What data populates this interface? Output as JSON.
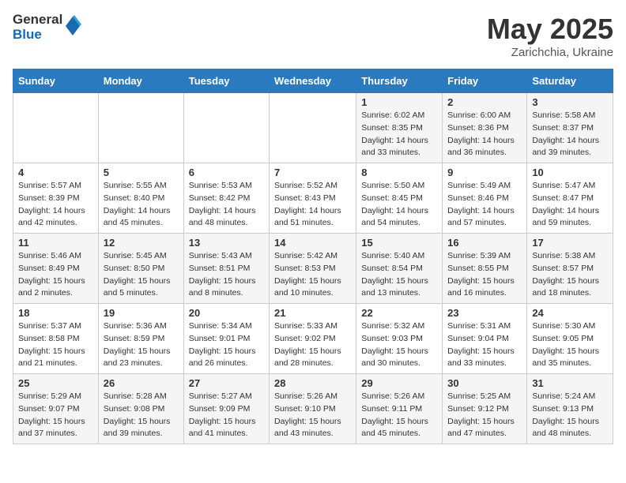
{
  "logo": {
    "general": "General",
    "blue": "Blue"
  },
  "title": {
    "month_year": "May 2025",
    "location": "Zarichchia, Ukraine"
  },
  "headers": [
    "Sunday",
    "Monday",
    "Tuesday",
    "Wednesday",
    "Thursday",
    "Friday",
    "Saturday"
  ],
  "weeks": [
    [
      {
        "day": "",
        "sunrise": "",
        "sunset": "",
        "daylight": ""
      },
      {
        "day": "",
        "sunrise": "",
        "sunset": "",
        "daylight": ""
      },
      {
        "day": "",
        "sunrise": "",
        "sunset": "",
        "daylight": ""
      },
      {
        "day": "",
        "sunrise": "",
        "sunset": "",
        "daylight": ""
      },
      {
        "day": "1",
        "sunrise": "Sunrise: 6:02 AM",
        "sunset": "Sunset: 8:35 PM",
        "daylight": "Daylight: 14 hours and 33 minutes."
      },
      {
        "day": "2",
        "sunrise": "Sunrise: 6:00 AM",
        "sunset": "Sunset: 8:36 PM",
        "daylight": "Daylight: 14 hours and 36 minutes."
      },
      {
        "day": "3",
        "sunrise": "Sunrise: 5:58 AM",
        "sunset": "Sunset: 8:37 PM",
        "daylight": "Daylight: 14 hours and 39 minutes."
      }
    ],
    [
      {
        "day": "4",
        "sunrise": "Sunrise: 5:57 AM",
        "sunset": "Sunset: 8:39 PM",
        "daylight": "Daylight: 14 hours and 42 minutes."
      },
      {
        "day": "5",
        "sunrise": "Sunrise: 5:55 AM",
        "sunset": "Sunset: 8:40 PM",
        "daylight": "Daylight: 14 hours and 45 minutes."
      },
      {
        "day": "6",
        "sunrise": "Sunrise: 5:53 AM",
        "sunset": "Sunset: 8:42 PM",
        "daylight": "Daylight: 14 hours and 48 minutes."
      },
      {
        "day": "7",
        "sunrise": "Sunrise: 5:52 AM",
        "sunset": "Sunset: 8:43 PM",
        "daylight": "Daylight: 14 hours and 51 minutes."
      },
      {
        "day": "8",
        "sunrise": "Sunrise: 5:50 AM",
        "sunset": "Sunset: 8:45 PM",
        "daylight": "Daylight: 14 hours and 54 minutes."
      },
      {
        "day": "9",
        "sunrise": "Sunrise: 5:49 AM",
        "sunset": "Sunset: 8:46 PM",
        "daylight": "Daylight: 14 hours and 57 minutes."
      },
      {
        "day": "10",
        "sunrise": "Sunrise: 5:47 AM",
        "sunset": "Sunset: 8:47 PM",
        "daylight": "Daylight: 14 hours and 59 minutes."
      }
    ],
    [
      {
        "day": "11",
        "sunrise": "Sunrise: 5:46 AM",
        "sunset": "Sunset: 8:49 PM",
        "daylight": "Daylight: 15 hours and 2 minutes."
      },
      {
        "day": "12",
        "sunrise": "Sunrise: 5:45 AM",
        "sunset": "Sunset: 8:50 PM",
        "daylight": "Daylight: 15 hours and 5 minutes."
      },
      {
        "day": "13",
        "sunrise": "Sunrise: 5:43 AM",
        "sunset": "Sunset: 8:51 PM",
        "daylight": "Daylight: 15 hours and 8 minutes."
      },
      {
        "day": "14",
        "sunrise": "Sunrise: 5:42 AM",
        "sunset": "Sunset: 8:53 PM",
        "daylight": "Daylight: 15 hours and 10 minutes."
      },
      {
        "day": "15",
        "sunrise": "Sunrise: 5:40 AM",
        "sunset": "Sunset: 8:54 PM",
        "daylight": "Daylight: 15 hours and 13 minutes."
      },
      {
        "day": "16",
        "sunrise": "Sunrise: 5:39 AM",
        "sunset": "Sunset: 8:55 PM",
        "daylight": "Daylight: 15 hours and 16 minutes."
      },
      {
        "day": "17",
        "sunrise": "Sunrise: 5:38 AM",
        "sunset": "Sunset: 8:57 PM",
        "daylight": "Daylight: 15 hours and 18 minutes."
      }
    ],
    [
      {
        "day": "18",
        "sunrise": "Sunrise: 5:37 AM",
        "sunset": "Sunset: 8:58 PM",
        "daylight": "Daylight: 15 hours and 21 minutes."
      },
      {
        "day": "19",
        "sunrise": "Sunrise: 5:36 AM",
        "sunset": "Sunset: 8:59 PM",
        "daylight": "Daylight: 15 hours and 23 minutes."
      },
      {
        "day": "20",
        "sunrise": "Sunrise: 5:34 AM",
        "sunset": "Sunset: 9:01 PM",
        "daylight": "Daylight: 15 hours and 26 minutes."
      },
      {
        "day": "21",
        "sunrise": "Sunrise: 5:33 AM",
        "sunset": "Sunset: 9:02 PM",
        "daylight": "Daylight: 15 hours and 28 minutes."
      },
      {
        "day": "22",
        "sunrise": "Sunrise: 5:32 AM",
        "sunset": "Sunset: 9:03 PM",
        "daylight": "Daylight: 15 hours and 30 minutes."
      },
      {
        "day": "23",
        "sunrise": "Sunrise: 5:31 AM",
        "sunset": "Sunset: 9:04 PM",
        "daylight": "Daylight: 15 hours and 33 minutes."
      },
      {
        "day": "24",
        "sunrise": "Sunrise: 5:30 AM",
        "sunset": "Sunset: 9:05 PM",
        "daylight": "Daylight: 15 hours and 35 minutes."
      }
    ],
    [
      {
        "day": "25",
        "sunrise": "Sunrise: 5:29 AM",
        "sunset": "Sunset: 9:07 PM",
        "daylight": "Daylight: 15 hours and 37 minutes."
      },
      {
        "day": "26",
        "sunrise": "Sunrise: 5:28 AM",
        "sunset": "Sunset: 9:08 PM",
        "daylight": "Daylight: 15 hours and 39 minutes."
      },
      {
        "day": "27",
        "sunrise": "Sunrise: 5:27 AM",
        "sunset": "Sunset: 9:09 PM",
        "daylight": "Daylight: 15 hours and 41 minutes."
      },
      {
        "day": "28",
        "sunrise": "Sunrise: 5:26 AM",
        "sunset": "Sunset: 9:10 PM",
        "daylight": "Daylight: 15 hours and 43 minutes."
      },
      {
        "day": "29",
        "sunrise": "Sunrise: 5:26 AM",
        "sunset": "Sunset: 9:11 PM",
        "daylight": "Daylight: 15 hours and 45 minutes."
      },
      {
        "day": "30",
        "sunrise": "Sunrise: 5:25 AM",
        "sunset": "Sunset: 9:12 PM",
        "daylight": "Daylight: 15 hours and 47 minutes."
      },
      {
        "day": "31",
        "sunrise": "Sunrise: 5:24 AM",
        "sunset": "Sunset: 9:13 PM",
        "daylight": "Daylight: 15 hours and 48 minutes."
      }
    ]
  ]
}
